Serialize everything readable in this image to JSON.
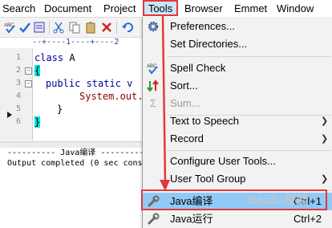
{
  "menubar": {
    "items": [
      "Search",
      "Document",
      "Project",
      "Tools",
      "Browser",
      "Emmet",
      "Window"
    ],
    "active": "Tools"
  },
  "editor": {
    "ruler": "--+----1----+----2",
    "line_numbers": [
      "1",
      "2",
      "3",
      "4",
      "5",
      "6"
    ],
    "lines": {
      "l1_kw": "class",
      "l1_name": " A",
      "l2": "{",
      "l3_kw": "public static v",
      "l4_obj": "System.out.",
      "l5": "}",
      "l6": "}"
    }
  },
  "output": {
    "header": "---------- Java编译 ----------",
    "line": "Output completed (0 sec consum"
  },
  "tools_menu": {
    "items": [
      {
        "label": "Preferences...",
        "icon": "gear-icon"
      },
      {
        "label": "Set Directories..."
      },
      {
        "label": "Spell Check",
        "icon": "spellcheck-icon"
      },
      {
        "label": "Sort...",
        "icon": "sort-icon"
      },
      {
        "label": "Sum...",
        "icon": "sum-icon",
        "disabled": true
      },
      {
        "label": "Text to Speech",
        "submenu": true
      },
      {
        "label": "Record",
        "submenu": true
      },
      {
        "label": "Configure User Tools..."
      },
      {
        "label": "User Tool Group",
        "submenu": true
      },
      {
        "label": "Java编译",
        "shortcut": "Ctrl+1",
        "icon": "wrench-icon",
        "highlighted": true
      },
      {
        "label": "Java运行",
        "shortcut": "Ctrl+2",
        "icon": "wrench-icon"
      }
    ]
  },
  "watermark": "Baidu经验",
  "colors": {
    "highlight": "#91c9f7",
    "annotation": "#e03a3a",
    "menu_bg": "#f2f2f2"
  }
}
